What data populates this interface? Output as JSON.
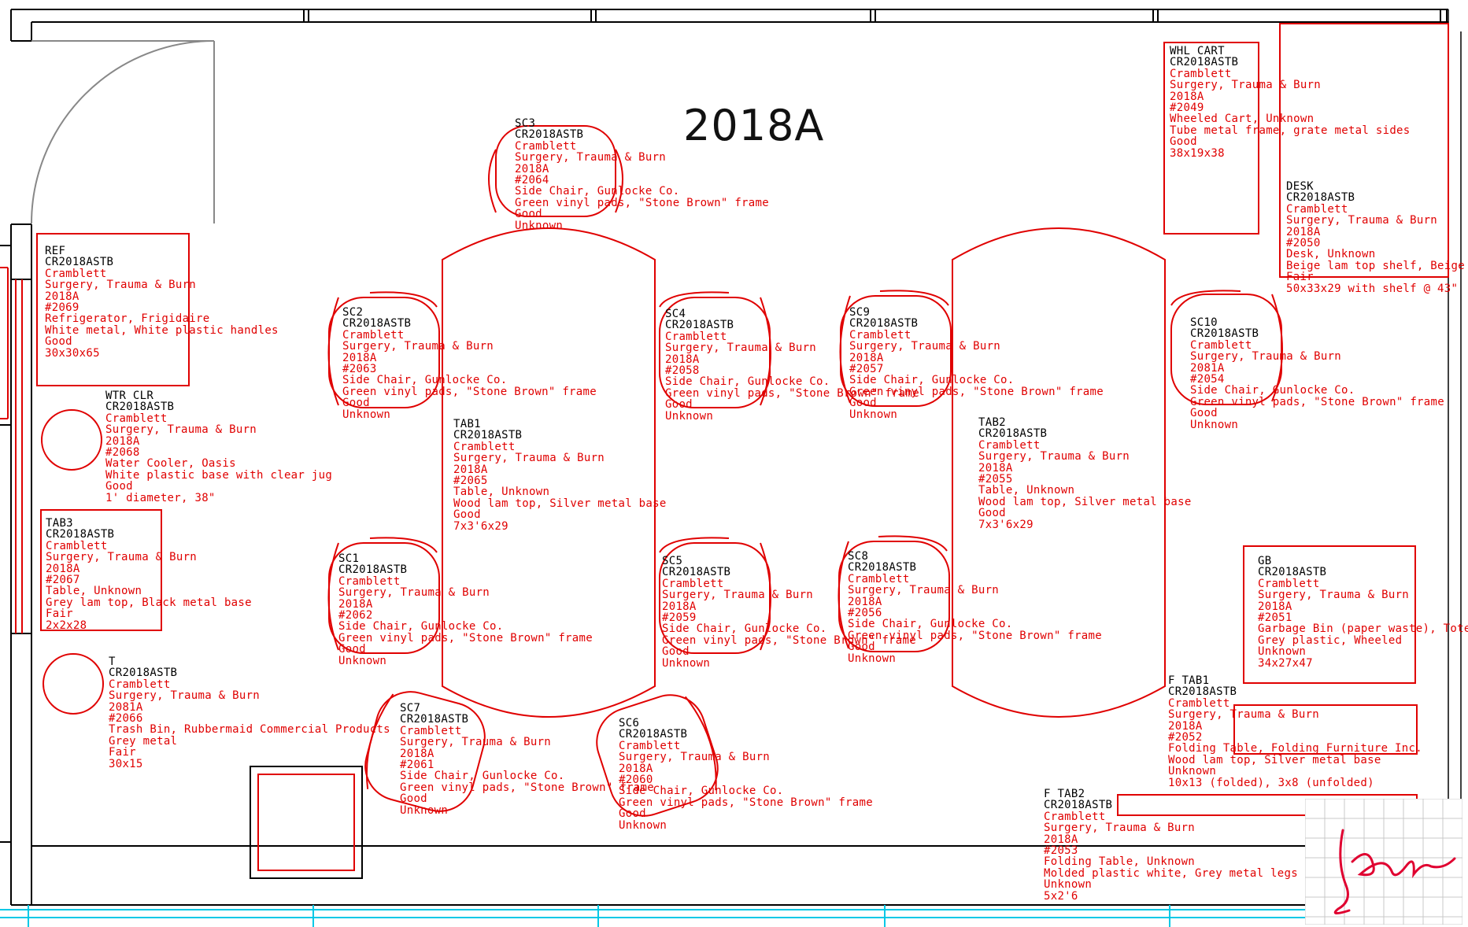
{
  "room_title": "2018A",
  "colors": {
    "furniture": "#e00000",
    "wall": "#000000",
    "window": "#00c8e6",
    "text_black": "#000000"
  },
  "items": {
    "sc3": [
      "SC3",
      "CR2018ASTB",
      "Cramblett",
      "Surgery, Trauma & Burn",
      "2018A",
      "#2064",
      "Side Chair, Gunlocke Co.",
      "Green vinyl pads, \"Stone Brown\" frame",
      "Good",
      "Unknown"
    ],
    "whl": [
      "WHL CART",
      "CR2018ASTB",
      "Cramblett",
      "Surgery, Trauma & Burn",
      "2018A",
      "#2049",
      "Wheeled Cart, Unknown",
      "Tube metal frame, grate metal sides",
      "Good",
      "38x19x38"
    ],
    "desk": [
      "DESK",
      "CR2018ASTB",
      "Cramblett",
      "Surgery, Trauma & Burn",
      "2018A",
      "#2050",
      "Desk, Unknown",
      "Beige lam top shelf, Beige m",
      "Fair",
      "50x33x29 with shelf @ 43\""
    ],
    "ref": [
      "REF",
      "CR2018ASTB",
      "Cramblett",
      "Surgery, Trauma & Burn",
      "2018A",
      "#2069",
      "Refrigerator, Frigidaire",
      "White metal, White plastic handles",
      "Good",
      "30x30x65"
    ],
    "sc2": [
      "SC2",
      "CR2018ASTB",
      "Cramblett",
      "Surgery, Trauma & Burn",
      "2018A",
      "#2063",
      "Side Chair, Gunlocke Co.",
      "Green vinyl pads, \"Stone Brown\" frame",
      "Good",
      "Unknown"
    ],
    "sc4": [
      "SC4",
      "CR2018ASTB",
      "Cramblett",
      "Surgery, Trauma & Burn",
      "2018A",
      "#2058",
      "Side Chair, Gunlocke Co.",
      "Green vinyl pads, \"Stone Brown\" frame",
      "Good",
      "Unknown"
    ],
    "sc9": [
      "SC9",
      "CR2018ASTB",
      "Cramblett",
      "Surgery, Trauma & Burn",
      "2018A",
      "#2057",
      "Side Chair, Gunlocke Co.",
      "Green vinyl pads, \"Stone Brown\" frame",
      "Good",
      "Unknown"
    ],
    "sc10": [
      "SC10",
      "CR2018ASTB",
      "Cramblett",
      "Surgery, Trauma & Burn",
      "2081A",
      "#2054",
      "Side Chair, Gunlocke Co.",
      "Green vinyl pads, \"Stone Brown\" frame",
      "Good",
      "Unknown"
    ],
    "wtr": [
      "WTR CLR",
      "CR2018ASTB",
      "Cramblett",
      "Surgery, Trauma & Burn",
      "2018A",
      "#2068",
      "Water Cooler, Oasis",
      "White plastic base with clear jug",
      "Good",
      "1' diameter, 38\""
    ],
    "tab1": [
      "TAB1",
      "CR2018ASTB",
      "Cramblett",
      "Surgery, Trauma & Burn",
      "2018A",
      "#2065",
      "Table, Unknown",
      "Wood lam top, Silver metal base",
      "Good",
      "7x3'6x29"
    ],
    "tab2": [
      "TAB2",
      "CR2018ASTB",
      "Cramblett",
      "Surgery, Trauma & Burn",
      "2018A",
      "#2055",
      "Table, Unknown",
      "Wood lam top, Silver metal base",
      "Good",
      "7x3'6x29"
    ],
    "tab3": [
      "TAB3",
      "CR2018ASTB",
      "Cramblett",
      "Surgery, Trauma & Burn",
      "2018A",
      "#2067",
      "Table, Unknown",
      "Grey lam top, Black metal base",
      "Fair",
      "2x2x28"
    ],
    "sc1": [
      "SC1",
      "CR2018ASTB",
      "Cramblett",
      "Surgery, Trauma & Burn",
      "2018A",
      "#2062",
      "Side Chair, Gunlocke Co.",
      "Green vinyl pads, \"Stone Brown\" frame",
      "Good",
      "Unknown"
    ],
    "sc5": [
      "SC5",
      "CR2018ASTB",
      "Cramblett",
      "Surgery, Trauma & Burn",
      "2018A",
      "#2059",
      "Side Chair, Gunlocke Co.",
      "Green vinyl pads, \"Stone Brown\" frame",
      "Good",
      "Unknown"
    ],
    "sc8": [
      "SC8",
      "CR2018ASTB",
      "Cramblett",
      "Surgery, Trauma & Burn",
      "2018A",
      "#2056",
      "Side Chair, Gunlocke Co.",
      "Green vinyl pads, \"Stone Brown\" frame",
      "Good",
      "Unknown"
    ],
    "gb": [
      "GB",
      "CR2018ASTB",
      "Cramblett",
      "Surgery, Trauma & Burn",
      "2018A",
      "#2051",
      "Garbage Bin (paper waste), Toter",
      "Grey plastic, Wheeled",
      "Unknown",
      "34x27x47"
    ],
    "t": [
      "T",
      "CR2018ASTB",
      "Cramblett",
      "Surgery, Trauma & Burn",
      "2081A",
      "#2066",
      "Trash Bin, Rubbermaid Commercial Products",
      "Grey metal",
      "Fair",
      "30x15"
    ],
    "sc7": [
      "SC7",
      "CR2018ASTB",
      "Cramblett",
      "Surgery, Trauma & Burn",
      "2018A",
      "#2061",
      "Side Chair, Gunlocke Co.",
      "Green vinyl pads, \"Stone Brown\" frame",
      "Good",
      "Unknown"
    ],
    "sc6": [
      "SC6",
      "CR2018ASTB",
      "Cramblett",
      "Surgery, Trauma & Burn",
      "2018A",
      "#2060",
      "Side Chair, Gunlocke Co.",
      "Green vinyl pads, \"Stone Brown\" frame",
      "Good",
      "Unknown"
    ],
    "ftab1": [
      "F TAB1",
      "CR2018ASTB",
      "Cramblett",
      "Surgery, Trauma & Burn",
      "2018A",
      "#2052",
      "Folding Table, Folding Furniture Inc.",
      "Wood lam top, Silver metal base",
      "Unknown",
      "10x13 (folded), 3x8 (unfolded)"
    ],
    "ftab2": [
      "F TAB2",
      "CR2018ASTB",
      "Cramblett",
      "Surgery, Trauma & Burn",
      "2018A",
      "#2053",
      "Folding Table, Unknown",
      "Molded plastic white, Grey metal legs",
      "Unknown",
      "5x2'6"
    ]
  }
}
